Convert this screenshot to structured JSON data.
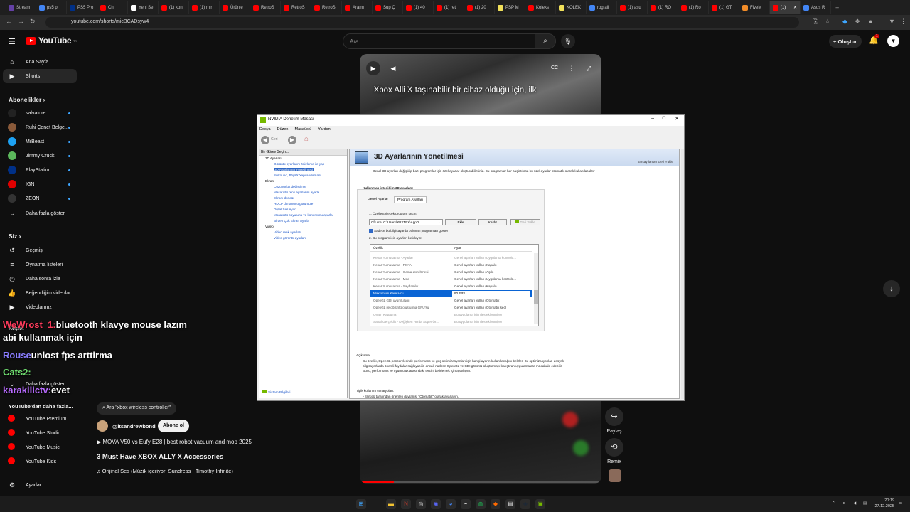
{
  "browser": {
    "tabs": [
      {
        "label": "Stream",
        "color": "#6441a5"
      },
      {
        "label": "ps5 pr",
        "color": "#4285f4"
      },
      {
        "label": "PS5 Pro",
        "color": "#003087"
      },
      {
        "label": "Ch",
        "color": "#ff0000"
      },
      {
        "label": "Yeni Se",
        "color": "#ffffff"
      },
      {
        "label": "(1) kon",
        "color": "#ff0000"
      },
      {
        "label": "(1) mir",
        "color": "#ff0000"
      },
      {
        "label": "Ürünle",
        "color": "#ff0000"
      },
      {
        "label": "RetroS",
        "color": "#ff0000"
      },
      {
        "label": "RetroS",
        "color": "#ff0000"
      },
      {
        "label": "RetroS",
        "color": "#ff0000"
      },
      {
        "label": "Aramı",
        "color": "#ff0000"
      },
      {
        "label": "Sup Ç",
        "color": "#ff0000"
      },
      {
        "label": "(1) 40",
        "color": "#ff0000"
      },
      {
        "label": "(1) reti",
        "color": "#ff0000"
      },
      {
        "label": "(1) 20",
        "color": "#ff0000"
      },
      {
        "label": "PSP M",
        "color": "#f1e05a"
      },
      {
        "label": "Koleks",
        "color": "#ff0000"
      },
      {
        "label": "KOLEK",
        "color": "#f1e05a"
      },
      {
        "label": "rog all",
        "color": "#4285f4"
      },
      {
        "label": "(1) asu",
        "color": "#ff0000"
      },
      {
        "label": "(1) RO",
        "color": "#ff0000"
      },
      {
        "label": "(1) Ro",
        "color": "#ff0000"
      },
      {
        "label": "(1) GT",
        "color": "#ff0000"
      },
      {
        "label": "FiveM",
        "color": "#f28c28"
      },
      {
        "label": "(1)",
        "color": "#ff0000"
      },
      {
        "label": "Asus R",
        "color": "#4285f4"
      }
    ],
    "url": "youtube.com/shorts/micBCADsyw4"
  },
  "youtube": {
    "logo": "YouTube",
    "logo_sup": "TR",
    "search_placeholder": "Ara",
    "create_label": "Oluştur",
    "notif_count": "1",
    "sidebar": {
      "home": "Ana Sayfa",
      "shorts": "Shorts",
      "subs_header": "Abonelikler",
      "subs": [
        {
          "name": "salvatore",
          "color": "#222"
        },
        {
          "name": "Ruhi Çenet Belge...",
          "color": "#8a5a3a"
        },
        {
          "name": "MrBeast",
          "color": "#1da1f2"
        },
        {
          "name": "Jimmy Cruck",
          "color": "#5cb85c"
        },
        {
          "name": "PlayStation",
          "color": "#003087"
        },
        {
          "name": "IGN",
          "color": "#e00000"
        },
        {
          "name": "ZEON",
          "color": "#333"
        }
      ],
      "more_subs": "Daha fazla göster",
      "you_header": "Siz",
      "you_items": [
        "Geçmiş",
        "Oynatma listeleri",
        "Daha sonra izle",
        "Beğendiğim videolar",
        "Videolarınız"
      ],
      "explore_header": "Keşfet",
      "more_explore": "Daha fazla göster",
      "more_yt_header": "YouTube'dan daha fazla...",
      "yt_items": [
        "YouTube Premium",
        "YouTube Studio",
        "YouTube Music",
        "YouTube Kids"
      ],
      "settings": "Ayarlar"
    },
    "video": {
      "subtitle": "Xbox Alli X taşınabilir bir cihaz olduğu için, ilk",
      "search_chip": "Ara \"xbox wireless controller\"",
      "channel": "@itsandrewbond",
      "subscribe": "Abone ol",
      "related": "▶ MOVA V50 vs Eufy E28 | best robot vacuum and mop 2025",
      "title": "3 Must Have XBOX ALLY X Accessories",
      "audio": "♫ Orijinal Ses (Müzik içeriyor: Sundress · Timothy Infinite)",
      "share": "Paylaş",
      "remix": "Remix"
    }
  },
  "chat": [
    {
      "user": "WeWrost_1:",
      "msg": "bluetooth klavye mouse lazım",
      "color": "#ff3b5c"
    },
    {
      "user": "",
      "msg": "abi kullanmak için",
      "color": "#ffffff"
    },
    {
      "user": "Rouse",
      "msg": "unlost fps arttirma",
      "color": "#8a7dff"
    },
    {
      "user": "Cats2:",
      "msg": "",
      "color": "#6fdc6f"
    },
    {
      "user": "karakilictv:",
      "msg": "evet",
      "color": "#b86bff"
    }
  ],
  "nvidia": {
    "title": "NVIDIA Denetim Masası",
    "menu": [
      "Dosya",
      "Düzen",
      "Masaüstü",
      "Yardım"
    ],
    "back": "Geri",
    "task_header": "Bir Görev Seçin...",
    "tree": [
      {
        "text": "3D Ayarları",
        "kind": "cat"
      },
      {
        "text": "Görüntü ayarlarını önizleme ile yap",
        "kind": "lnk"
      },
      {
        "text": "3D Ayarlarının Yönetilmesi",
        "kind": "sel"
      },
      {
        "text": "Surround, PhysX Yapılandırması",
        "kind": "lnk"
      },
      {
        "text": "Ekran",
        "kind": "cat"
      },
      {
        "text": "Çözünürlük değiştirme",
        "kind": "lnk"
      },
      {
        "text": "Masaüstü renk ayarlarını ayarla",
        "kind": "lnk"
      },
      {
        "text": "Ekranı döndür",
        "kind": "lnk"
      },
      {
        "text": "HDCP durumunu görüntüle",
        "kind": "lnk"
      },
      {
        "text": "Dijital Ses Ayarı",
        "kind": "lnk"
      },
      {
        "text": "Masaüstü boyutunu ve konumunu ayarla",
        "kind": "lnk"
      },
      {
        "text": "Birden Çok Ekran Ayarla",
        "kind": "lnk"
      },
      {
        "text": "Video",
        "kind": "cat"
      },
      {
        "text": "Video renk ayarları",
        "kind": "lnk"
      },
      {
        "text": "Video görüntü ayarları",
        "kind": "lnk"
      }
    ],
    "system_info": "Sistem Bilgileri",
    "page_title": "3D Ayarlarının Yönetilmesi",
    "restore": "Varsayılanları Geri Yükle",
    "intro": "Genel 3D ayarları değiştirip bazı programlar için özel ayarlar oluşturabilirsiniz. Bu programlar her başlatılırsa bu özel ayarlar otomatik olarak kullanılacaktır",
    "use_label": "Kullanmak istediğim 3D ayarları:",
    "tab_global": "Genel Ayarlar",
    "tab_program": "Program Ayarları",
    "step1": "1. Özelleştirilecek program seçin:",
    "program": "Cfs.rce: C:\\Users\\XBXTEX\\AppD...",
    "add": "Ekle",
    "remove": "Kaldır",
    "restore_small": "Geri Yükle",
    "only_found": "Sadece bu bilgisayarda bulunan programları göster",
    "step2": "2. Bu program için ayarları belirleyin:",
    "col_feature": "Özellik",
    "col_setting": "Ayar",
    "rows": [
      {
        "f": "Kenar Yumuşatma - Ayarlar",
        "s": "Genel ayarları kullan (Uygulama kontrolü...",
        "kind": "dim"
      },
      {
        "f": "Kenar Yumuşatma - FXAA",
        "s": "Genel ayarları kullan (Kapalı)",
        "kind": ""
      },
      {
        "f": "Kenar Yumuşatma - Gama düzeltmesi",
        "s": "Genel ayarları kullan (Açık)",
        "kind": ""
      },
      {
        "f": "Kenar Yumuşatma - Mod",
        "s": "Genel ayarları kullan (Uygulama kontrolü...",
        "kind": ""
      },
      {
        "f": "Kenar Yumuşatma - Saydamlık",
        "s": "Genel ayarları kullan (Kapalı)",
        "kind": ""
      },
      {
        "f": "Maksimum Kare Hızı",
        "s": "90 FPS",
        "kind": "hl"
      },
      {
        "f": "OpenGL GDI uyumluluğu",
        "s": "Genel ayarları kullan (Otomatik)",
        "kind": ""
      },
      {
        "f": "OpenGL ile görüntü oluşturma GPU'su",
        "s": "Genel ayarları kullan (Otomatik seç)",
        "kind": ""
      },
      {
        "f": "Ortam Kapatma",
        "s": "Bu uygulama için desteklenmiyor",
        "kind": "dim"
      },
      {
        "f": "Sanal Gerçeklik - Değişken Hızda Süper Ör...",
        "s": "Bu uygulama için desteklenmiyor",
        "kind": "dim"
      }
    ],
    "desc_label": "Açıklama:",
    "desc": "Bu özellik, OpenGL pencerelerinde performans ve güç optimizasyonları için hangi ayarın kullanılacağını belirler. Bu optimizasyonlar, dosyalı bilgisayarlarda önemli faydalar sağlayabilir, ancak nadiren OpenGL ve GDI görüntü oluşturmayı karıştıran uygulamalara müdahale edebilir. Bunu, performans ve uyumluluk arasındaki tercihi belirlemek için ayarlayın.",
    "usage_label": "Tipik kullanım senaryoları:",
    "usage_1": "• Sürücü tarafından önerilen davranışı \"Otomatik\" olarak ayarlayın."
  },
  "tray": {
    "time": "20:19",
    "date": "27.12.2025"
  }
}
